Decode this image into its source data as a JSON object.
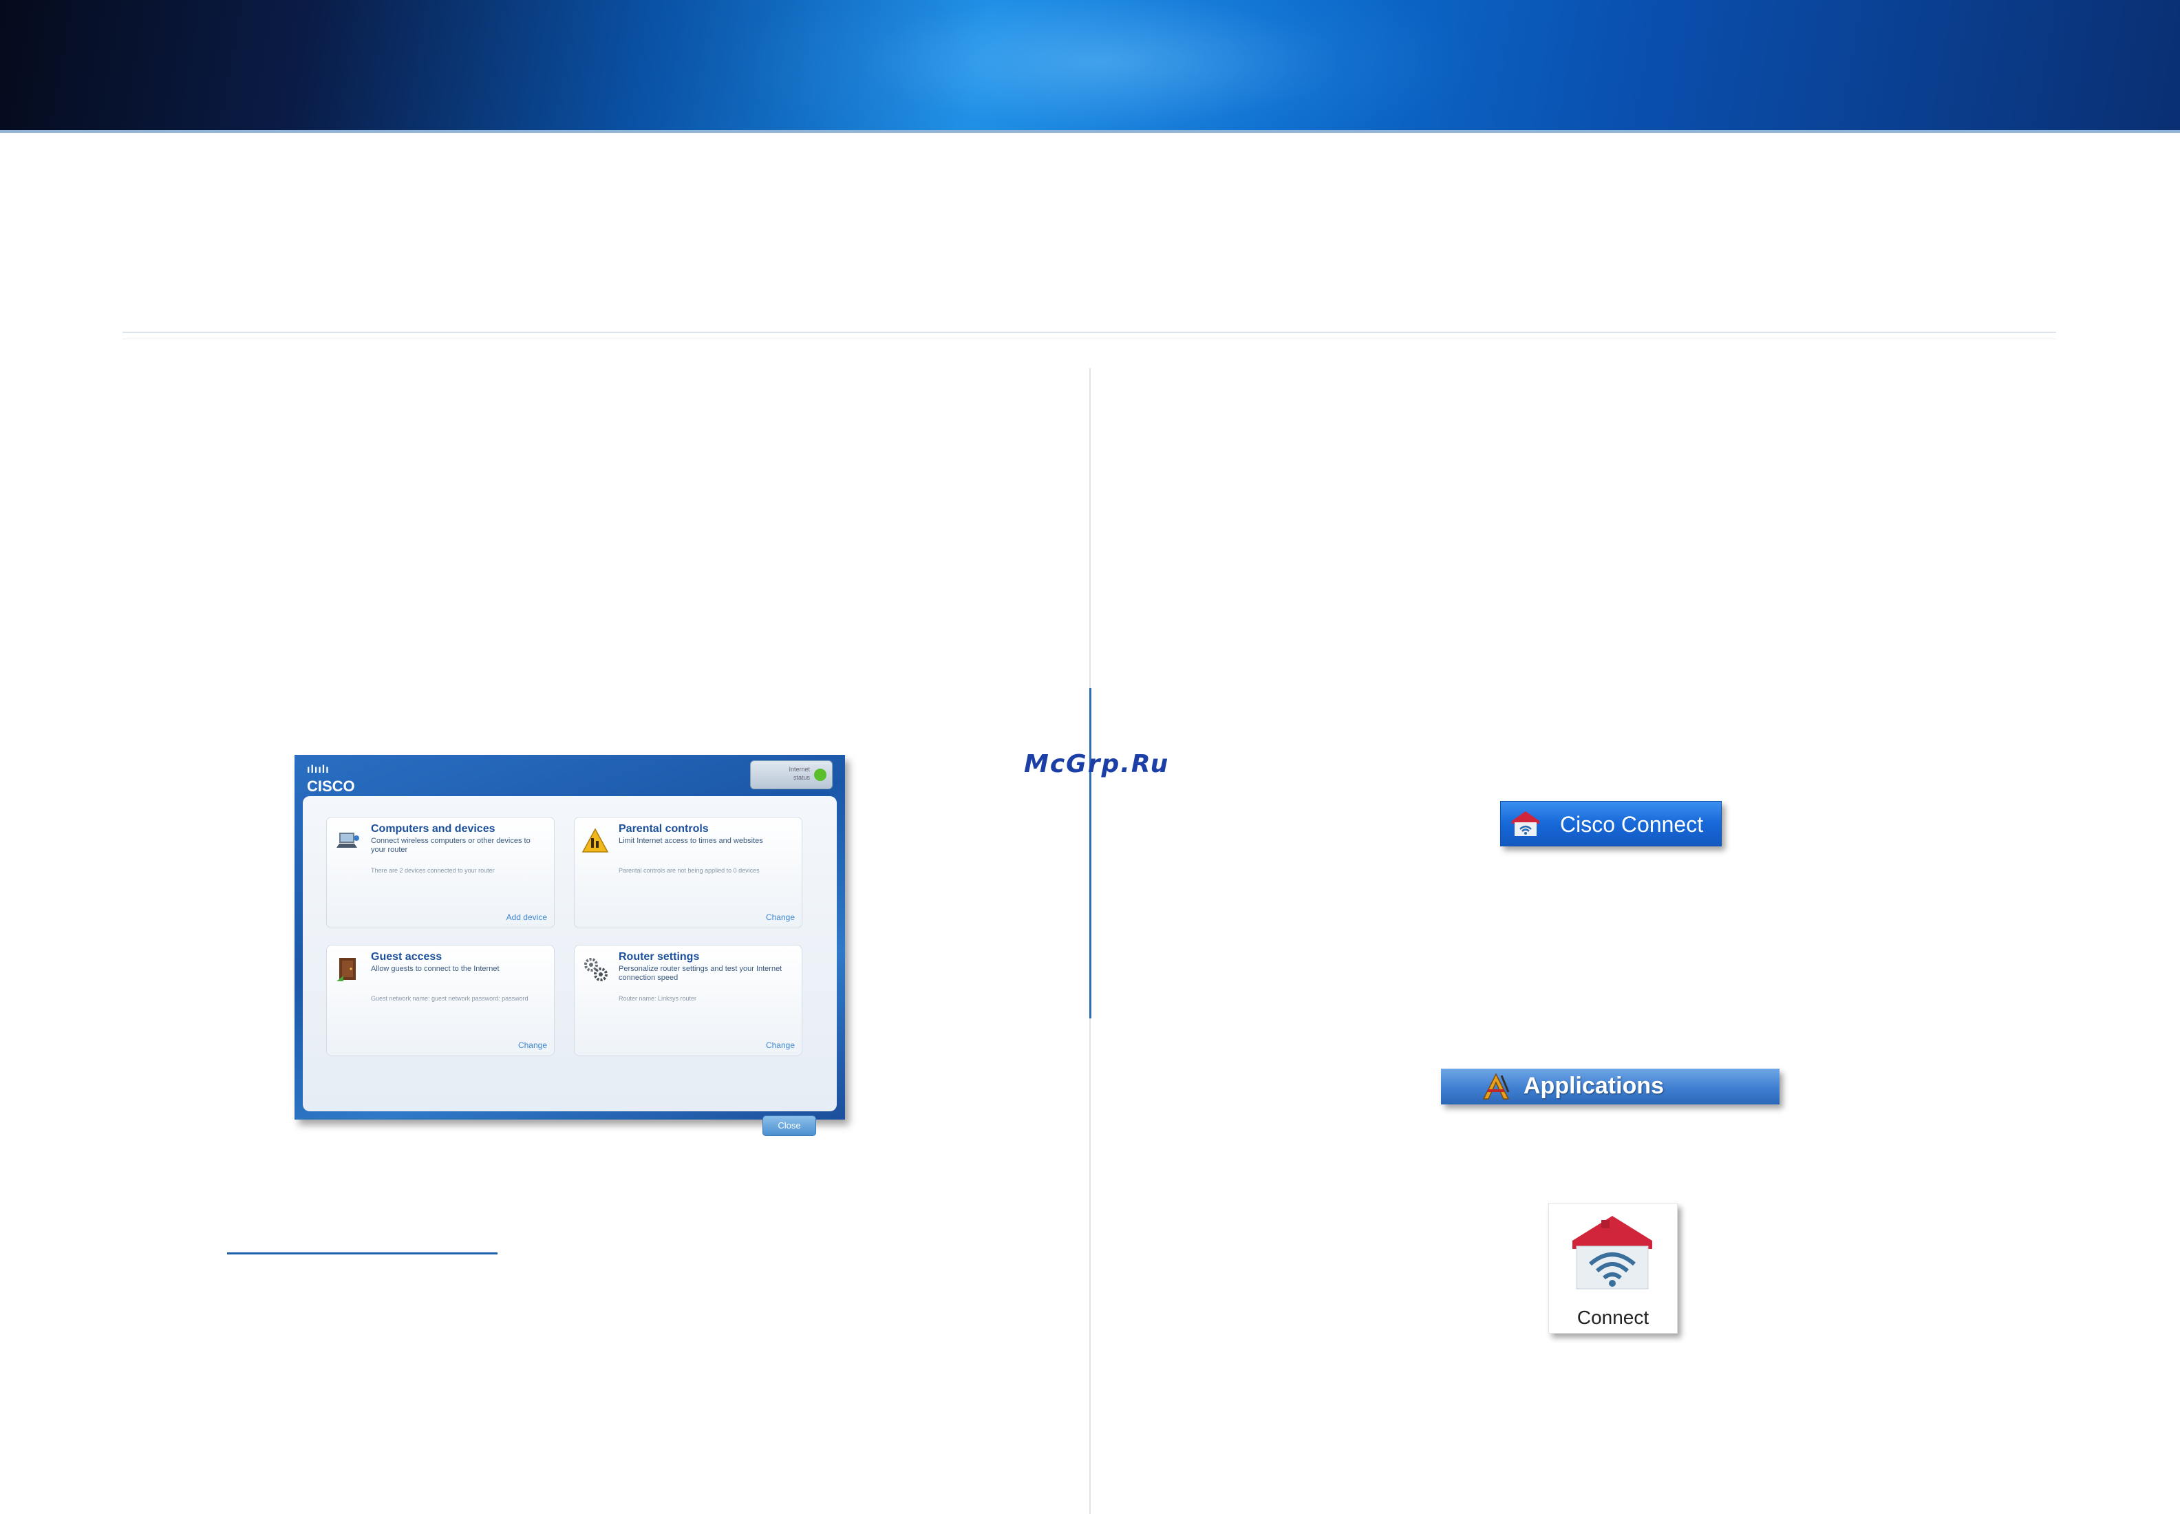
{
  "watermark": "McGrp.Ru",
  "cisco_window": {
    "logo_bars": "ılıılı",
    "logo_text": "CISCO",
    "status_text": "Internet\nstatus",
    "cards": [
      {
        "title": "Computers and devices",
        "description": "Connect wireless computers or other devices to your router",
        "note": "There are 2 devices connected to your router",
        "action": "Add device"
      },
      {
        "title": "Parental controls",
        "description": "Limit Internet access to times and websites",
        "note": "Parental controls are not being applied to 0 devices",
        "action": "Change"
      },
      {
        "title": "Guest access",
        "description": "Allow guests to connect to the Internet",
        "note": "Guest network name: guest network password: password",
        "action": "Change"
      },
      {
        "title": "Router settings",
        "description": "Personalize router settings and test your Internet connection speed",
        "note": "Router name: Linksys router",
        "action": "Change"
      }
    ],
    "close_label": "Close"
  },
  "cisco_connect_button": {
    "label": "Cisco Connect"
  },
  "applications_bar": {
    "label": "Applications"
  },
  "connect_tile": {
    "label": "Connect"
  },
  "colors": {
    "banner_dark": "#050b1c",
    "banner_bright": "#1c8fe6",
    "accent_blue": "#1f5fb0",
    "house_red": "#d0253a"
  }
}
